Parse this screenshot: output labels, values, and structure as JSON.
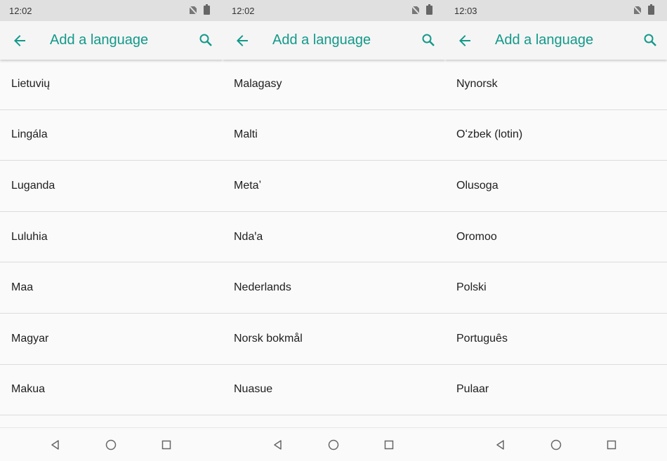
{
  "screens": [
    {
      "status_time": "12:02",
      "title": "Add a language",
      "languages": [
        "Lietuvių",
        "Lingála",
        "Luganda",
        "Luluhia",
        "Maa",
        "Magyar",
        "Makua"
      ]
    },
    {
      "status_time": "12:02",
      "title": "Add a language",
      "languages": [
        "Malagasy",
        "Malti",
        "Metaʼ",
        "Ndaꞌa",
        "Nederlands",
        "Norsk bokmål",
        "Nuasue"
      ]
    },
    {
      "status_time": "12:03",
      "title": "Add a language",
      "languages": [
        "Nynorsk",
        "Oʻzbek (lotin)",
        "Olusoga",
        "Oromoo",
        "Polski",
        "Português",
        "Pulaar"
      ]
    }
  ],
  "icons": {
    "back": "arrow-left-icon",
    "search": "search-icon",
    "sim": "no-sim-icon",
    "battery": "battery-icon",
    "nav_back": "triangle-back-icon",
    "nav_home": "circle-home-icon",
    "nav_recent": "square-recent-icon"
  },
  "colors": {
    "accent": "#12998a",
    "statusbar": "#e0e0e0",
    "background": "#fafafa"
  }
}
